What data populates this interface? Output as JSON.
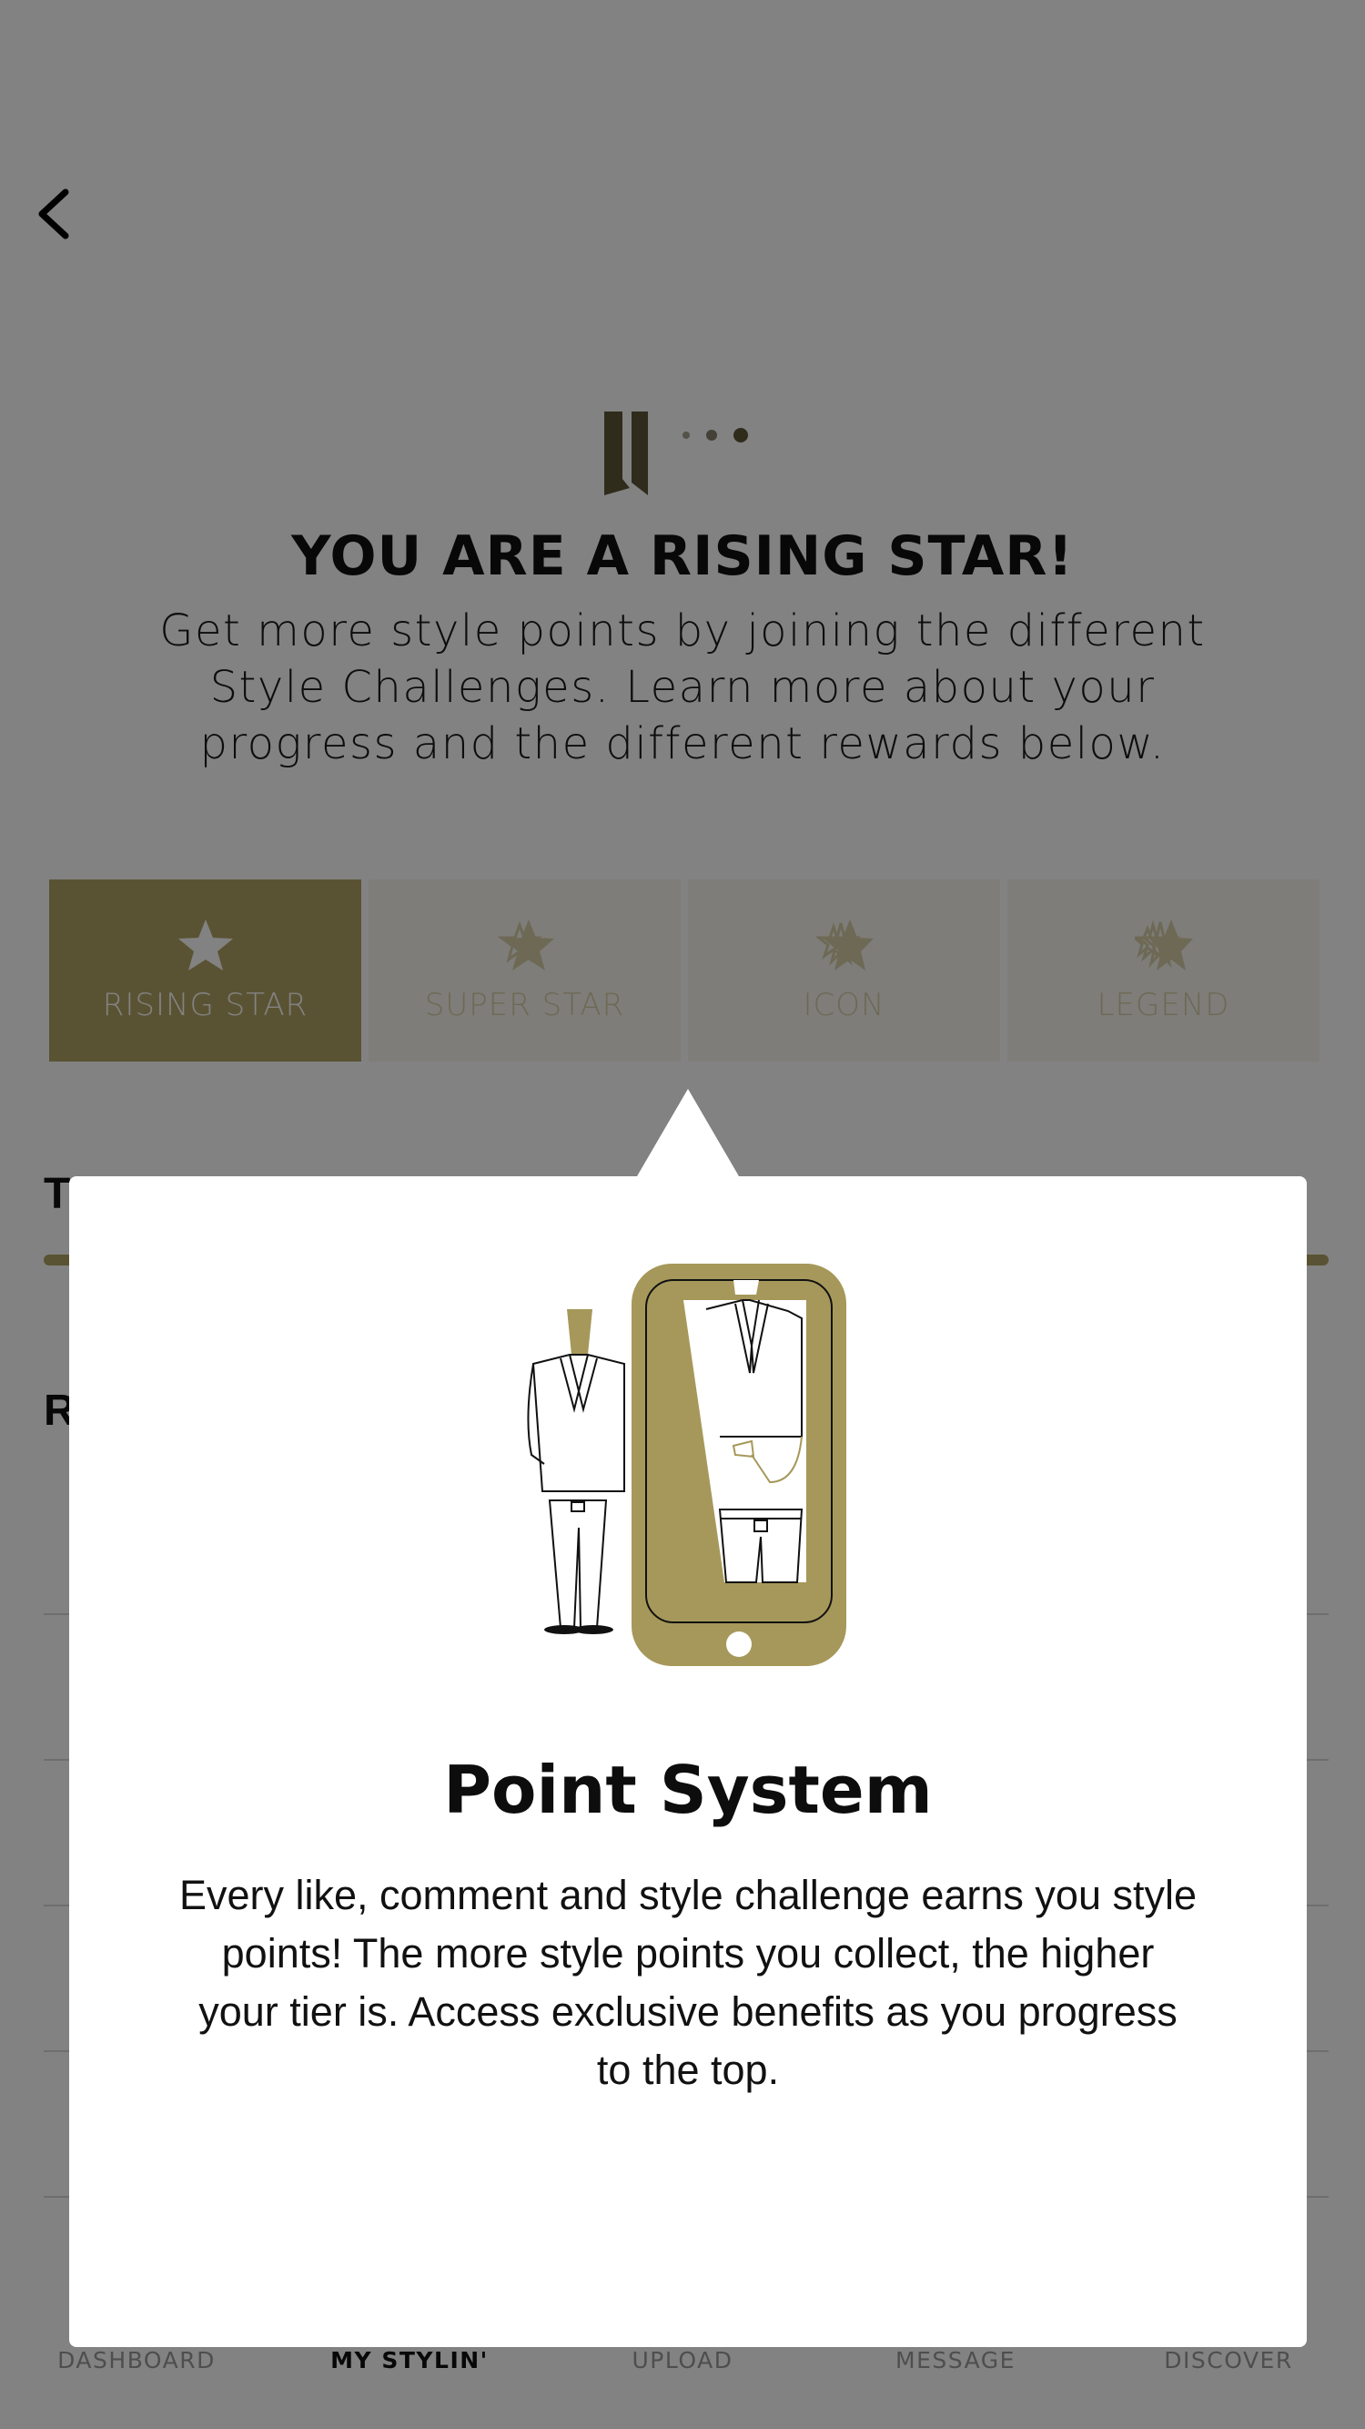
{
  "header": {
    "back_icon": "chevron-left-icon",
    "headline": "YOU ARE A RISING STAR!",
    "subtitle": "Get more style points by joining the different Style Challenges. Learn more about your progress and the different rewards below."
  },
  "tiers": [
    {
      "label": "RISING STAR",
      "active": true
    },
    {
      "label": "SUPER STAR",
      "active": false
    },
    {
      "label": "ICON",
      "active": false
    },
    {
      "label": "LEGEND",
      "active": false
    }
  ],
  "background": {
    "section1_initial": "T",
    "section2_initial": "R",
    "progress_value_partial": "0"
  },
  "modal": {
    "title": "Point System",
    "body": "Every like, comment and style challenge earns you style points! The more style points you collect, the higher your tier is. Access exclusive benefits as you progress to the top."
  },
  "bottom_nav": [
    {
      "label": "DASHBOARD",
      "active": false
    },
    {
      "label": "MY STYLIN'",
      "active": true
    },
    {
      "label": "UPLOAD",
      "active": false
    },
    {
      "label": "MESSAGE",
      "active": false
    },
    {
      "label": "DISCOVER",
      "active": false
    }
  ],
  "colors": {
    "accent_gold": "#b1a365",
    "overlay": "rgba(0,0,0,0.49)"
  }
}
